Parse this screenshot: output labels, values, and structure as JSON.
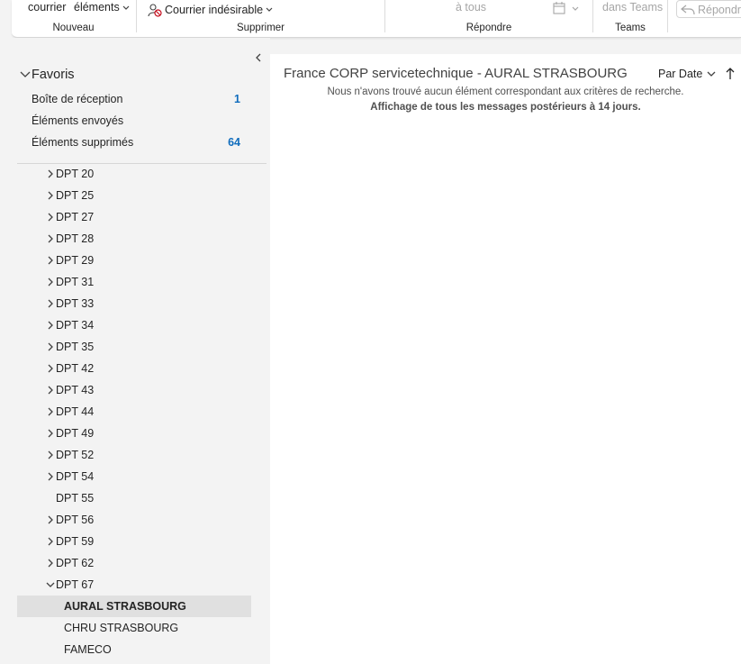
{
  "ribbon": {
    "nouveau": {
      "label": "Nouveau",
      "btn1": "courrier",
      "btn2": "éléments"
    },
    "supprimer": {
      "label": "Supprimer",
      "junk": "Courrier indésirable"
    },
    "repondre": {
      "label": "Répondre",
      "reply_all": "à tous"
    },
    "teams": {
      "label": "Teams",
      "share": "dans Teams"
    },
    "reply_partial": "Répondr"
  },
  "favorites": {
    "header": "Favoris",
    "items": [
      {
        "label": "Boîte de réception",
        "count": "1"
      },
      {
        "label": "Éléments envoyés",
        "count": ""
      },
      {
        "label": "Éléments supprimés",
        "count": "64"
      }
    ]
  },
  "folders": [
    {
      "label": "DPT 20",
      "chevron": "right"
    },
    {
      "label": "DPT 25",
      "chevron": "right"
    },
    {
      "label": "DPT 27",
      "chevron": "right"
    },
    {
      "label": "DPT 28",
      "chevron": "right"
    },
    {
      "label": "DPT 29",
      "chevron": "right"
    },
    {
      "label": "DPT 31",
      "chevron": "right"
    },
    {
      "label": "DPT 33",
      "chevron": "right"
    },
    {
      "label": "DPT 34",
      "chevron": "right"
    },
    {
      "label": "DPT 35",
      "chevron": "right"
    },
    {
      "label": "DPT 42",
      "chevron": "right"
    },
    {
      "label": "DPT 43",
      "chevron": "right"
    },
    {
      "label": "DPT 44",
      "chevron": "right"
    },
    {
      "label": "DPT 49",
      "chevron": "right"
    },
    {
      "label": "DPT 52",
      "chevron": "right"
    },
    {
      "label": "DPT 54",
      "chevron": "right"
    },
    {
      "label": "DPT 55",
      "chevron": "none"
    },
    {
      "label": "DPT 56",
      "chevron": "right"
    },
    {
      "label": "DPT 59",
      "chevron": "right"
    },
    {
      "label": "DPT 62",
      "chevron": "right"
    },
    {
      "label": "DPT 67",
      "chevron": "down"
    }
  ],
  "subfolders": [
    {
      "label": "AURAL STRASBOURG",
      "selected": true
    },
    {
      "label": "CHRU STRASBOURG",
      "selected": false
    },
    {
      "label": "FAMECO",
      "selected": false
    }
  ],
  "main": {
    "title": "France CORP servicetechnique - AURAL STRASBOURG",
    "sort_label": "Par Date",
    "empty_message": "Nous n'avons trouvé aucun élément correspondant aux critères de recherche.",
    "info_message": "Affichage de tous les messages postérieurs à 14 jours."
  },
  "colors": {
    "accent": "#0f6cbd",
    "selected_bg": "#e0e0e0"
  }
}
